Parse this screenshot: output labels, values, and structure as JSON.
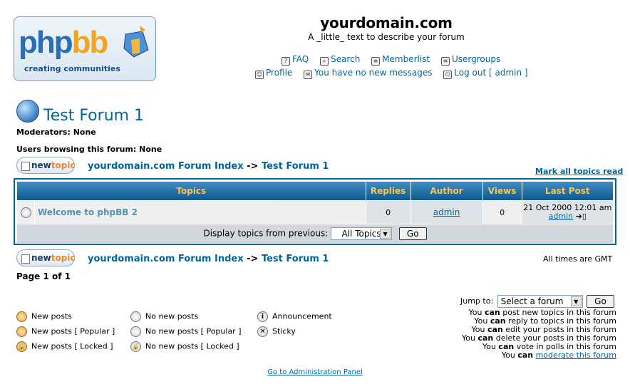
{
  "header": {
    "site_title": "yourdomain.com",
    "site_desc": "A _little_ text to describe your forum",
    "logo": {
      "word_php": "php",
      "word_bb": "bb",
      "tagline": "creating communities"
    },
    "nav_row1": [
      {
        "label": "FAQ",
        "icon": "faq-icon"
      },
      {
        "label": "Search",
        "icon": "search-icon"
      },
      {
        "label": "Memberlist",
        "icon": "memberlist-icon"
      },
      {
        "label": "Usergroups",
        "icon": "usergroups-icon"
      }
    ],
    "nav_row2": [
      {
        "label": "Profile",
        "icon": "profile-icon"
      },
      {
        "label": "You have no new messages",
        "icon": "messages-icon"
      },
      {
        "label": "Log out [ admin ]",
        "icon": "logout-icon"
      }
    ]
  },
  "forum": {
    "title": "Test Forum 1",
    "moderators": "Moderators: None",
    "users_browsing": "Users browsing this forum: None"
  },
  "buttons": {
    "new_prefix": "new",
    "new_suffix": "topic",
    "go": "Go"
  },
  "breadcrumb": {
    "index": "yourdomain.com Forum Index",
    "sep": "->",
    "forum": "Test Forum 1"
  },
  "mark_all": "Mark all topics read",
  "table": {
    "headers": [
      "Topics",
      "Replies",
      "Author",
      "Views",
      "Last Post"
    ],
    "row": {
      "topic": "Welcome to phpBB 2",
      "replies": "0",
      "author": "admin",
      "views": "0",
      "last_post_date": "21 Oct 2000 12:01 am",
      "last_post_author": "admin"
    },
    "display_label": "Display topics from previous:",
    "display_value": "All Topics"
  },
  "times_note": "All times are GMT",
  "pagination": "Page 1 of 1",
  "legend": {
    "new_posts": "New posts",
    "new_posts_popular": "New posts [ Popular ]",
    "new_posts_locked": "New posts [ Locked ]",
    "no_new_posts": "No new posts",
    "no_new_posts_popular": "No new posts [ Popular ]",
    "no_new_posts_locked": "No new posts [ Locked ]",
    "announcement": "Announcement",
    "sticky": "Sticky"
  },
  "jump": {
    "label": "Jump to:",
    "value": "Select a forum"
  },
  "auth": [
    {
      "pre": "You ",
      "can": "can",
      "post": " post new topics in this forum"
    },
    {
      "pre": "You ",
      "can": "can",
      "post": " reply to topics in this forum"
    },
    {
      "pre": "You ",
      "can": "can",
      "post": " edit your posts in this forum"
    },
    {
      "pre": "You ",
      "can": "can",
      "post": " delete your posts in this forum"
    },
    {
      "pre": "You ",
      "can": "can",
      "post": " vote in polls in this forum"
    },
    {
      "pre": "You ",
      "can": "can",
      "post": " ",
      "link": "moderate this forum"
    }
  ],
  "admin_link": "Go to Administration Panel"
}
